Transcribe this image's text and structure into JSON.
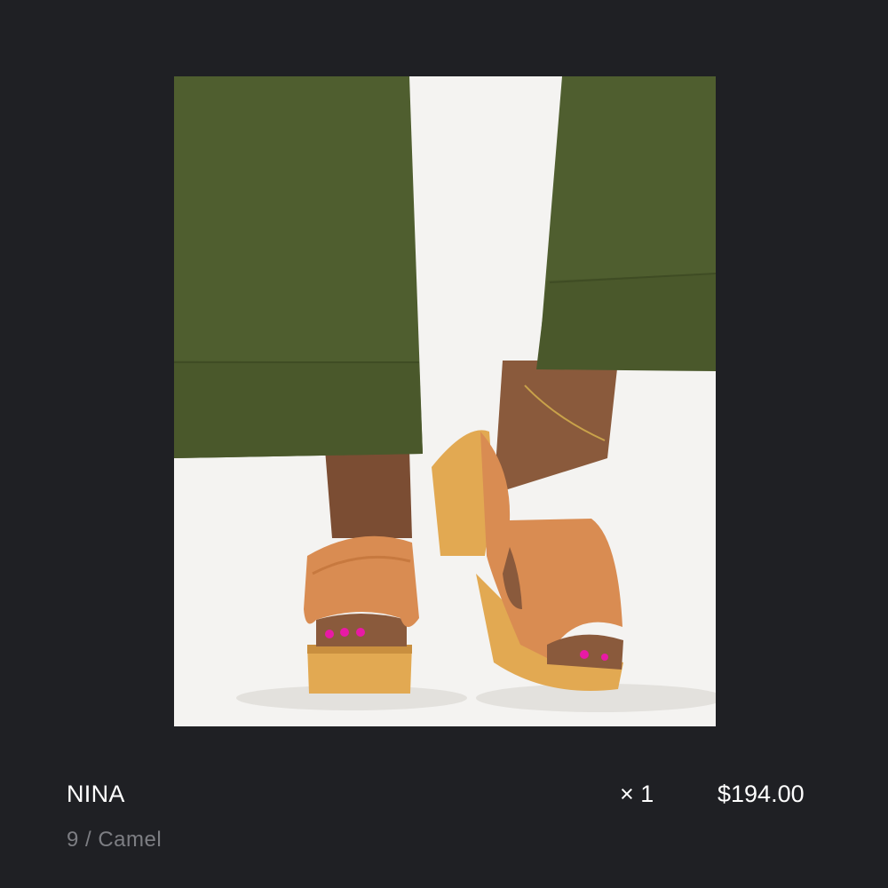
{
  "line_item": {
    "name": "NINA",
    "variant": "9 / Camel",
    "quantity": "× 1",
    "price": "$194.00"
  },
  "colors": {
    "background": "#1f2024",
    "text_primary": "#ffffff",
    "text_secondary": "#7d7e83",
    "pants": "#4f5e2f",
    "shoe_leather": "#d98c52",
    "shoe_heel": "#e2a952",
    "skin": "#8a5a3c",
    "nail_polish": "#e81aa5",
    "photo_background": "#f4f3f1"
  }
}
